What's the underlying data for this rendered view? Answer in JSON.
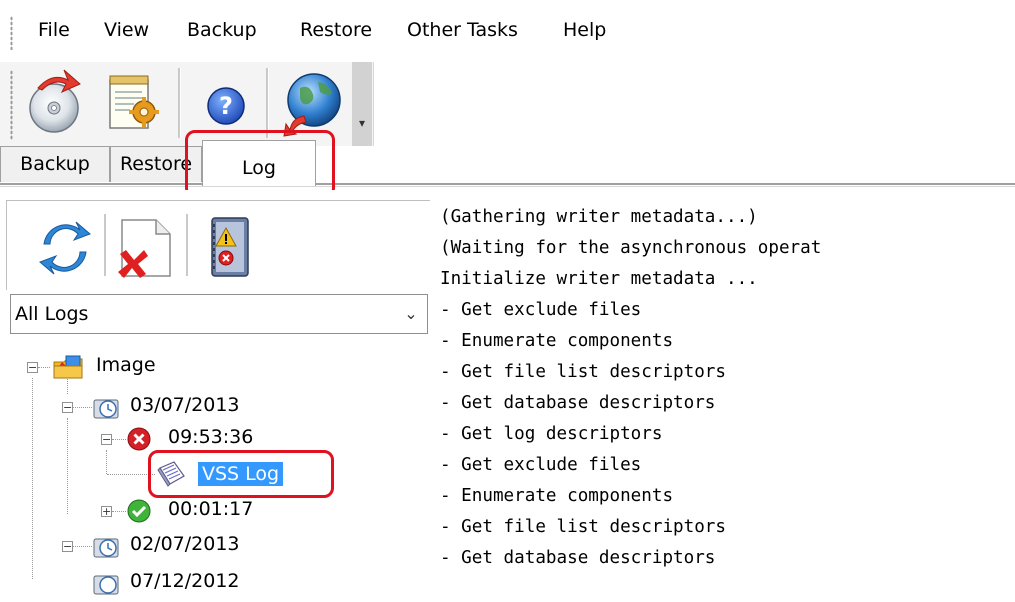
{
  "menu": {
    "items": [
      "File",
      "View",
      "Backup",
      "Restore",
      "Other Tasks",
      "Help"
    ]
  },
  "toolbar": {
    "buttons": [
      {
        "name": "backup-disc-icon"
      },
      {
        "name": "task-settings-icon"
      },
      {
        "name": "help-icon"
      },
      {
        "name": "web-globe-icon"
      }
    ]
  },
  "tabs": {
    "backup": "Backup",
    "restore": "Restore",
    "log": "Log"
  },
  "log_panel": {
    "filter_value": "All Logs"
  },
  "tree": {
    "root": "Image",
    "date1": "03/07/2013",
    "time1": "09:53:36",
    "vss_log": "VSS Log",
    "time2": "00:01:17",
    "date2": "02/07/2013",
    "date3": "07/12/2012"
  },
  "log_text": {
    "lines": [
      "(Gathering writer metadata...)",
      "(Waiting for the asynchronous operat",
      "Initialize writer metadata ...",
      "- Get exclude files",
      "- Enumerate components",
      "- Get file list descriptors",
      "- Get database descriptors",
      "- Get log descriptors",
      "- Get exclude files",
      "- Enumerate components",
      "- Get file list descriptors",
      "- Get database descriptors"
    ]
  },
  "colors": {
    "annotation_red": "#e0121f",
    "selection_blue": "#3399ff",
    "error_red": "#d42027",
    "success_green": "#3fb33a"
  }
}
